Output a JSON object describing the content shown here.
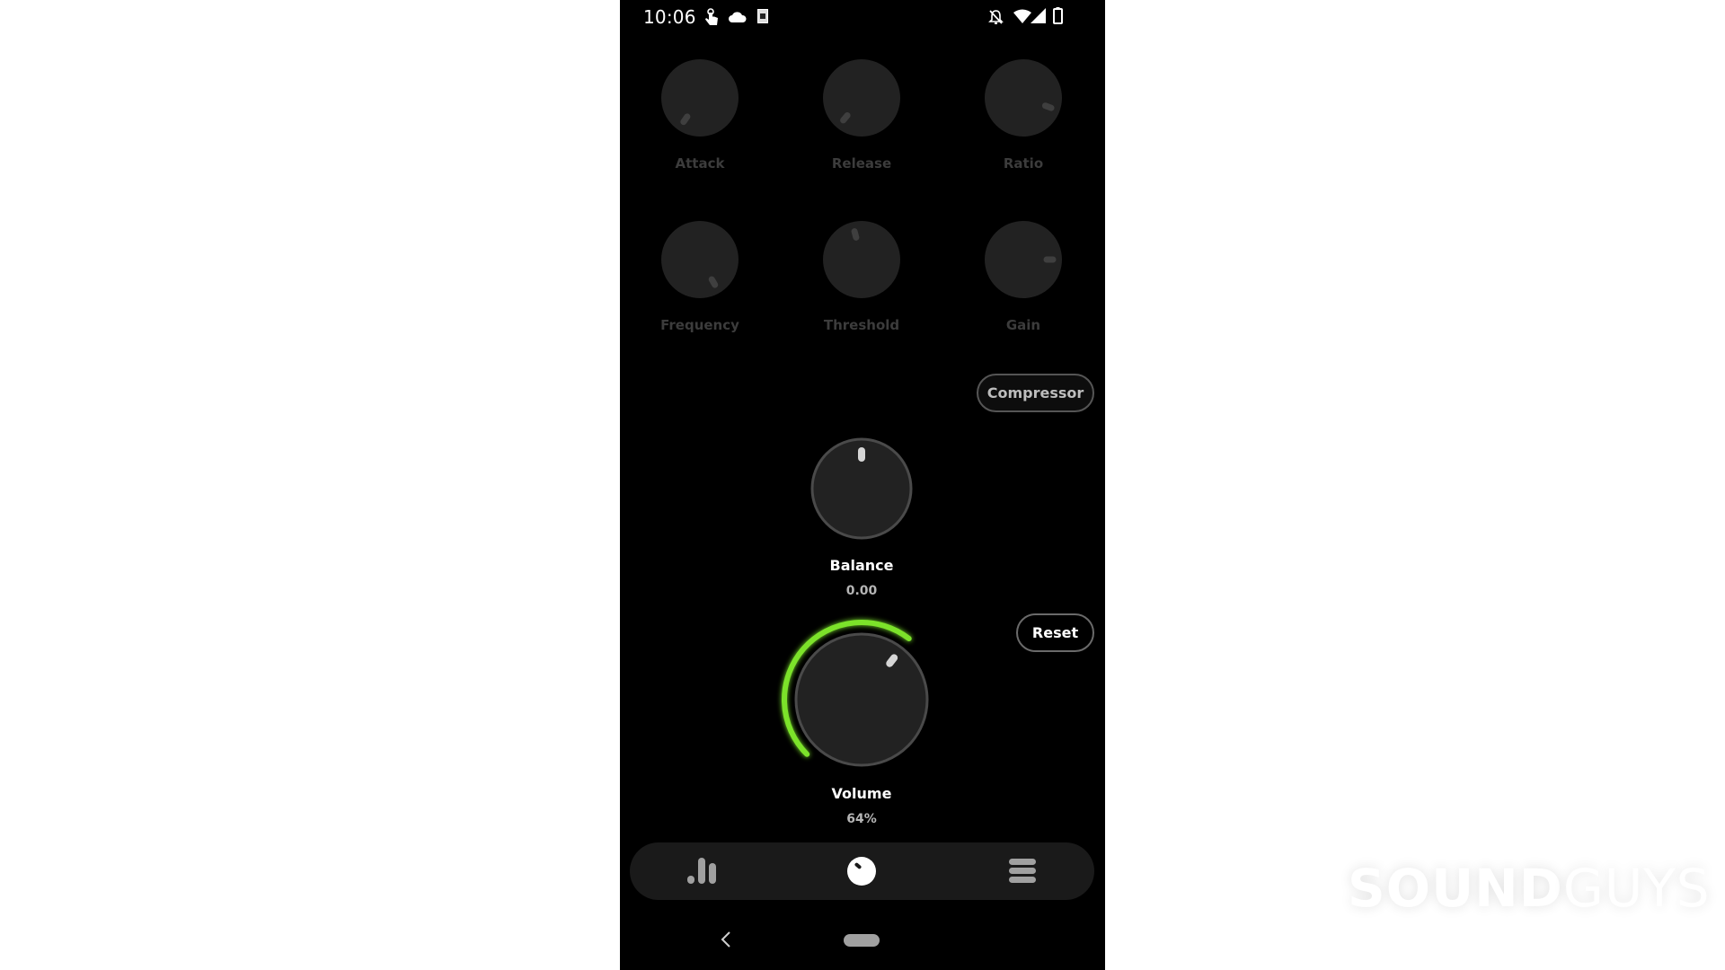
{
  "status_bar": {
    "time": "10:06",
    "left_icons": [
      "touch-gesture-icon",
      "cloud-icon",
      "sim-card-icon"
    ],
    "right_icons": [
      "bell-off-icon",
      "wifi-icon",
      "cellular-signal-icon",
      "battery-icon"
    ]
  },
  "compressor_knobs": [
    {
      "label": "Attack",
      "indicator_angle_deg": -145
    },
    {
      "label": "Release",
      "indicator_angle_deg": -140
    },
    {
      "label": "Ratio",
      "indicator_angle_deg": 110
    },
    {
      "label": "Frequency",
      "indicator_angle_deg": 150
    },
    {
      "label": "Threshold",
      "indicator_angle_deg": -15
    },
    {
      "label": "Gain",
      "indicator_angle_deg": 90
    }
  ],
  "compressor_button": {
    "label": "Compressor"
  },
  "balance": {
    "label": "Balance",
    "value": "0.00"
  },
  "reset_button": {
    "label": "Reset"
  },
  "volume": {
    "label": "Volume",
    "value": "64%",
    "fraction": 0.64
  },
  "colors": {
    "accent": "#7be22c",
    "background": "#000000",
    "knob": "#222222"
  },
  "bottom_nav": {
    "items": [
      {
        "name": "equalizer",
        "icon": "bar-chart-icon",
        "active": false
      },
      {
        "name": "knobs",
        "icon": "knob-icon",
        "active": true
      },
      {
        "name": "presets",
        "icon": "list-icon",
        "active": false
      }
    ]
  },
  "system_nav": {
    "back": "back-icon",
    "home": "home-pill"
  },
  "watermark": {
    "bold": "SOUND",
    "light": "GUYS"
  }
}
